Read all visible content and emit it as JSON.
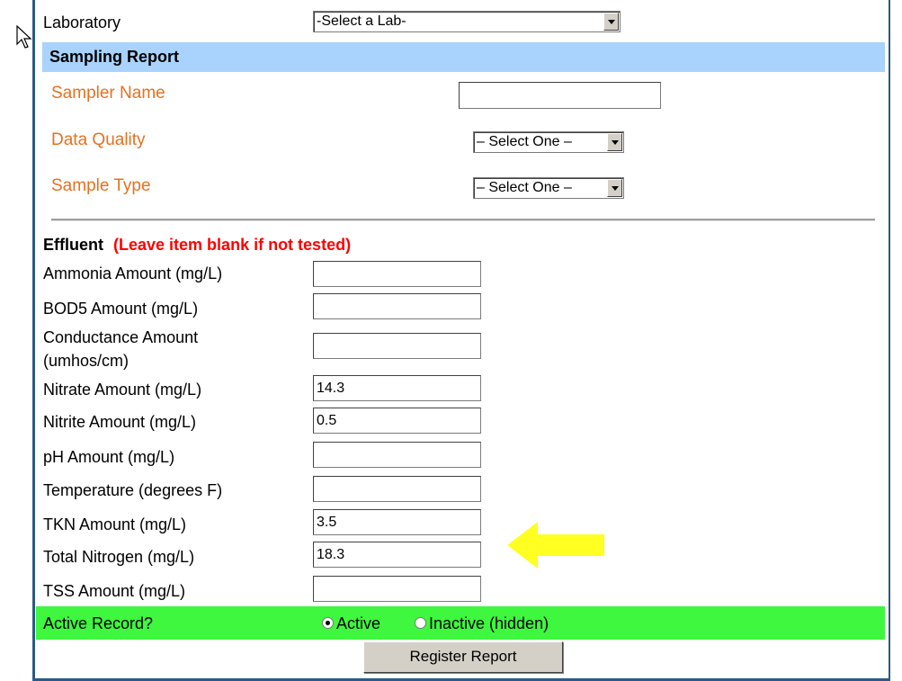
{
  "lab": {
    "label": "Laboratory",
    "select_value": "-Select a Lab-"
  },
  "sampling": {
    "heading": "Sampling Report",
    "sampler_name_label": "Sampler Name",
    "data_quality_label": "Data Quality",
    "data_quality_value": "– Select One –",
    "sample_type_label": "Sample Type",
    "sample_type_value": "– Select One –"
  },
  "effluent": {
    "heading": "Effluent",
    "note": "(Leave item blank if not tested)",
    "fields": [
      {
        "label": "Ammonia Amount (mg/L)",
        "value": ""
      },
      {
        "label": "BOD5 Amount (mg/L)",
        "value": ""
      },
      {
        "label_line1": "Conductance Amount",
        "label_line2": "(umhos/cm)",
        "value": ""
      },
      {
        "label": "Nitrate Amount (mg/L)",
        "value": "14.3"
      },
      {
        "label": "Nitrite Amount (mg/L)",
        "value": "0.5"
      },
      {
        "label": "pH Amount (mg/L)",
        "value": ""
      },
      {
        "label": "Temperature (degrees F)",
        "value": ""
      },
      {
        "label": "TKN Amount (mg/L)",
        "value": "3.5"
      },
      {
        "label": "Total Nitrogen (mg/L)",
        "value": "18.3"
      },
      {
        "label": "TSS Amount (mg/L)",
        "value": ""
      }
    ]
  },
  "active": {
    "label": "Active Record?",
    "option_active": "Active",
    "option_inactive": "Inactive (hidden)",
    "selected": "Active"
  },
  "submit_label": "Register Report",
  "colors": {
    "section_header": "#a9d2fc",
    "active_row": "#3ef73e",
    "field_label_orange": "#e8701f",
    "note_red": "#ff0000",
    "highlight_arrow": "#ffff22"
  }
}
